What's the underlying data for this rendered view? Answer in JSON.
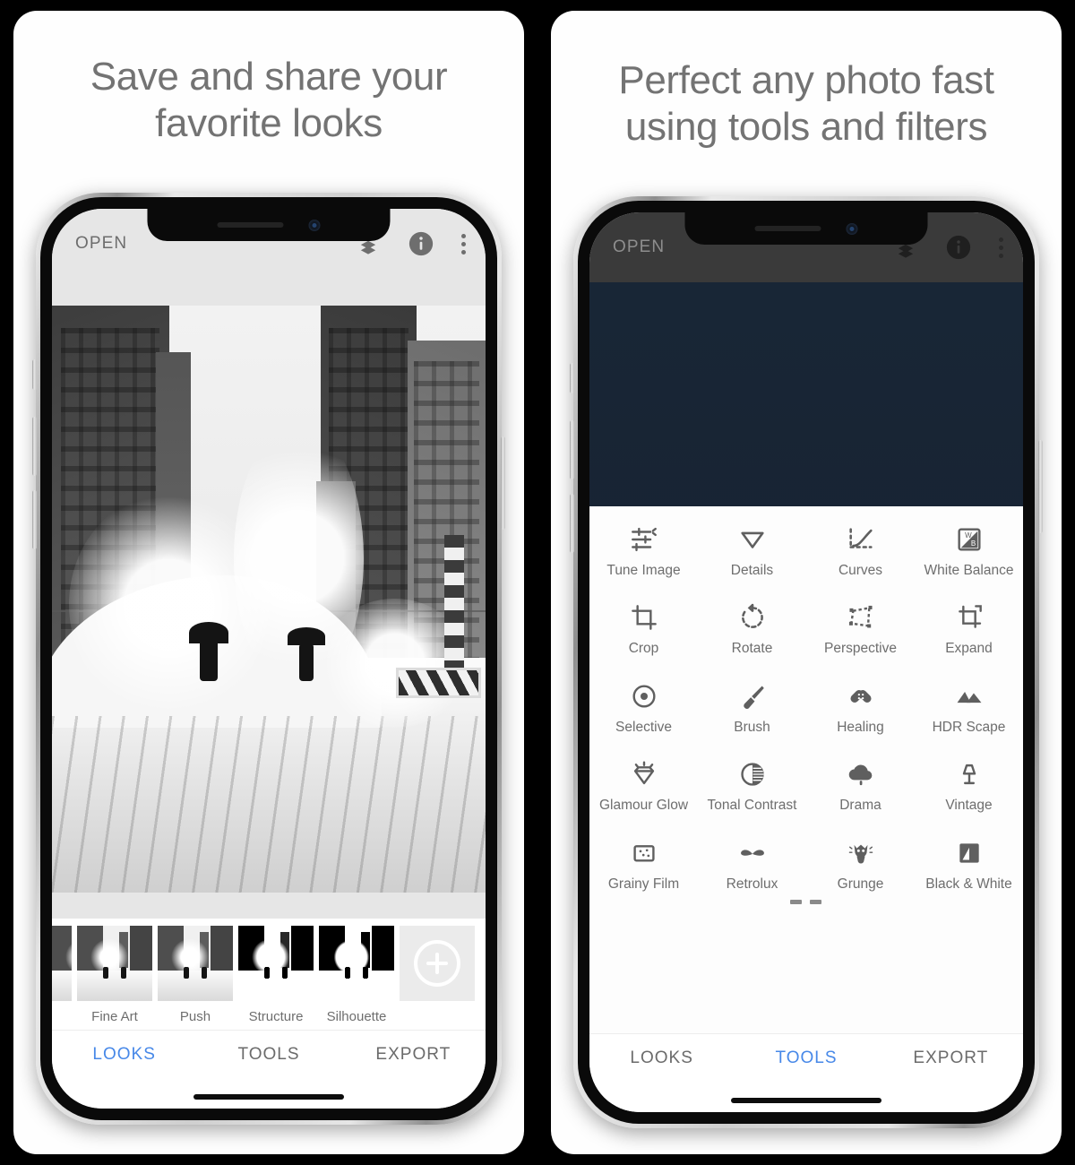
{
  "panels": [
    {
      "headline": "Save and share your favorite looks",
      "headline_lines": [
        "Save and share your",
        "favorite looks"
      ],
      "theme": "light",
      "appbar": {
        "open_label": "OPEN",
        "icons": [
          "undo-layers-icon",
          "info-icon",
          "overflow-menu-icon"
        ]
      },
      "looks": {
        "items": [
          {
            "label": "Fine Art",
            "style": "normal"
          },
          {
            "label": "Push",
            "style": "normal"
          },
          {
            "label": "Structure",
            "style": "contrast"
          },
          {
            "label": "Silhouette",
            "style": "hi"
          }
        ],
        "add_label": "+"
      },
      "tabs": [
        {
          "label": "LOOKS",
          "active": true
        },
        {
          "label": "TOOLS",
          "active": false
        },
        {
          "label": "EXPORT",
          "active": false
        }
      ]
    },
    {
      "headline": "Perfect any photo fast using tools and filters",
      "headline_lines": [
        "Perfect any photo fast",
        "using tools and filters"
      ],
      "theme": "dark",
      "appbar": {
        "open_label": "OPEN",
        "icons": [
          "undo-layers-icon",
          "info-icon",
          "overflow-menu-icon"
        ]
      },
      "tools": [
        {
          "label": "Tune Image",
          "icon": "sliders-icon"
        },
        {
          "label": "Details",
          "icon": "triangle-down-icon"
        },
        {
          "label": "Curves",
          "icon": "curves-icon"
        },
        {
          "label": "White Balance",
          "icon": "white-balance-icon"
        },
        {
          "label": "Crop",
          "icon": "crop-icon"
        },
        {
          "label": "Rotate",
          "icon": "rotate-icon"
        },
        {
          "label": "Perspective",
          "icon": "perspective-icon"
        },
        {
          "label": "Expand",
          "icon": "expand-icon"
        },
        {
          "label": "Selective",
          "icon": "selective-target-icon"
        },
        {
          "label": "Brush",
          "icon": "brush-icon"
        },
        {
          "label": "Healing",
          "icon": "healing-bandage-icon"
        },
        {
          "label": "HDR Scape",
          "icon": "mountains-icon"
        },
        {
          "label": "Glamour Glow",
          "icon": "diamond-glow-icon"
        },
        {
          "label": "Tonal Contrast",
          "icon": "contrast-circle-icon"
        },
        {
          "label": "Drama",
          "icon": "cloud-rain-icon"
        },
        {
          "label": "Vintage",
          "icon": "lamp-icon"
        },
        {
          "label": "Grainy Film",
          "icon": "grain-square-icon"
        },
        {
          "label": "Retrolux",
          "icon": "moustache-icon"
        },
        {
          "label": "Grunge",
          "icon": "grunge-skull-icon"
        },
        {
          "label": "Black & White",
          "icon": "black-white-icon"
        }
      ],
      "tabs": [
        {
          "label": "LOOKS",
          "active": false
        },
        {
          "label": "TOOLS",
          "active": true
        },
        {
          "label": "EXPORT",
          "active": false
        }
      ]
    }
  ],
  "colors": {
    "accent": "#4788e8",
    "headline": "#737373",
    "appbar_light": "#e6e6e6",
    "appbar_dark": "#3a3a3a",
    "photo_navy": "#182636",
    "background": "#000000"
  }
}
